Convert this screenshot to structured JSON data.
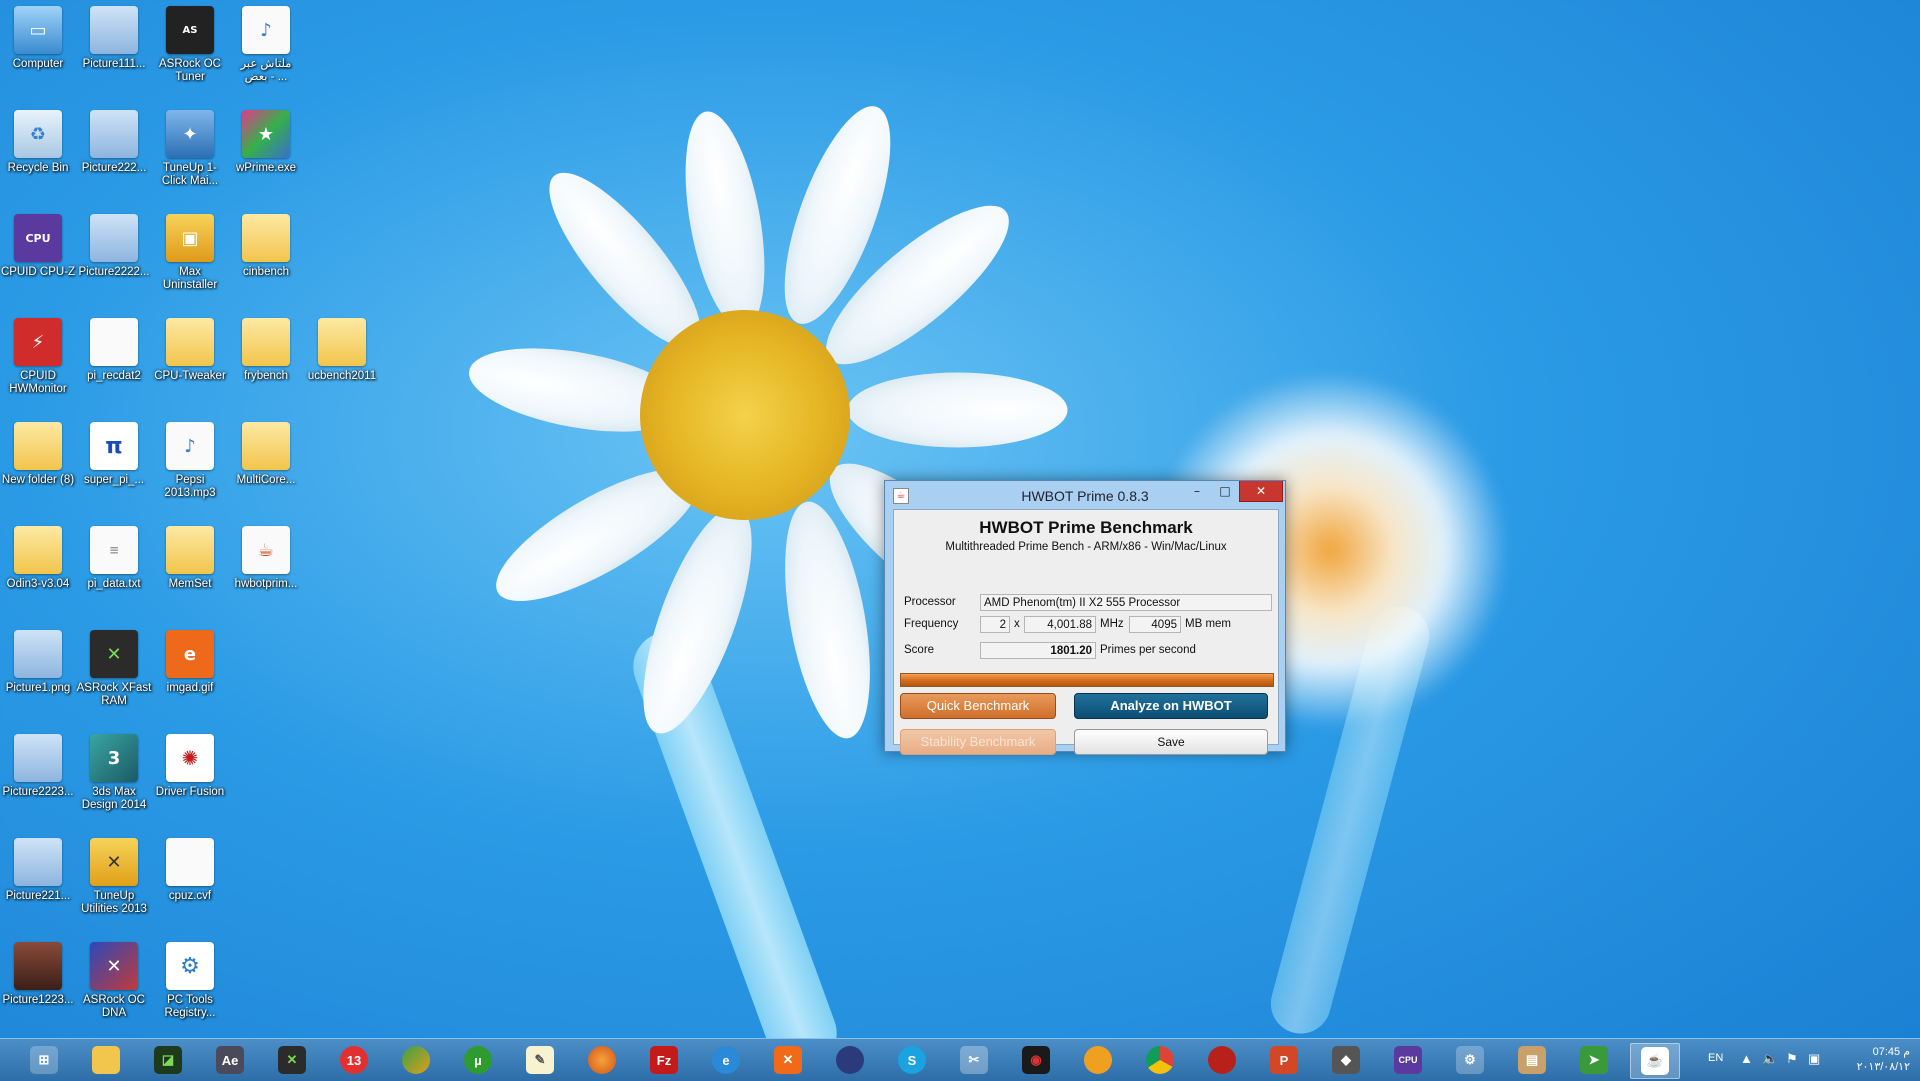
{
  "desktop": {
    "icons": [
      {
        "label": "Computer"
      },
      {
        "label": "Picture111..."
      },
      {
        "label": "ASRock OC Tuner"
      },
      {
        "label": "ملتاش عبر بعض - ..."
      },
      {
        "label": "Recycle Bin"
      },
      {
        "label": "Picture222..."
      },
      {
        "label": "TuneUp 1-Click Mai..."
      },
      {
        "label": "wPrime.exe"
      },
      {
        "label": "CPUID CPU-Z"
      },
      {
        "label": "Picture2222..."
      },
      {
        "label": "Max Uninstaller"
      },
      {
        "label": "cinbench"
      },
      {
        "label": "CPUID HWMonitor"
      },
      {
        "label": "pi_recdat2"
      },
      {
        "label": "CPU-Tweaker"
      },
      {
        "label": "frybench"
      },
      {
        "label": "ucbench2011"
      },
      {
        "label": "New folder (8)"
      },
      {
        "label": "super_pi_..."
      },
      {
        "label": "Pepsi 2013.mp3"
      },
      {
        "label": "MultiCore..."
      },
      {
        "label": "Odin3-v3.04"
      },
      {
        "label": "pi_data.txt"
      },
      {
        "label": "MemSet"
      },
      {
        "label": "hwbotprim..."
      },
      {
        "label": "Picture1.png"
      },
      {
        "label": "ASRock XFast RAM"
      },
      {
        "label": "imgad.gif"
      },
      {
        "label": "Picture2223..."
      },
      {
        "label": "3ds Max Design 2014"
      },
      {
        "label": "Driver Fusion"
      },
      {
        "label": "Picture221..."
      },
      {
        "label": "TuneUp Utilities 2013"
      },
      {
        "label": "cpuz.cvf"
      },
      {
        "label": "Picture1223..."
      },
      {
        "label": "ASRock OC DNA"
      },
      {
        "label": "PC Tools Registry..."
      }
    ]
  },
  "window": {
    "title": "HWBOT Prime 0.8.3",
    "heading": "HWBOT Prime Benchmark",
    "subheading": "Multithreaded Prime Bench - ARM/x86 - Win/Mac/Linux",
    "processor_label": "Processor",
    "processor_value": "AMD Phenom(tm) II X2 555 Processor",
    "frequency_label": "Frequency",
    "cores": "2",
    "times": "x",
    "mhz_value": "4,001.88",
    "mhz_unit": "MHz",
    "mem_value": "4095",
    "mem_unit": "MB mem",
    "score_label": "Score",
    "score_value": "1801.20",
    "score_unit": "Primes per second",
    "progress": 1.0,
    "quick_label": "Quick Benchmark",
    "analyze_label": "Analyze on HWBOT",
    "stability_label": "Stability Benchmark",
    "save_label": "Save",
    "min_glyph": "–",
    "max_glyph": "□",
    "close_glyph": "✕"
  },
  "taskbar": {
    "lang": "EN",
    "time": "07:45 م",
    "date": "٢٠١٣/٠٨/١٢"
  },
  "colors": {
    "accent_orange": "#d76e1e",
    "accent_blue": "#0d4d73",
    "close_red": "#c7372f"
  }
}
